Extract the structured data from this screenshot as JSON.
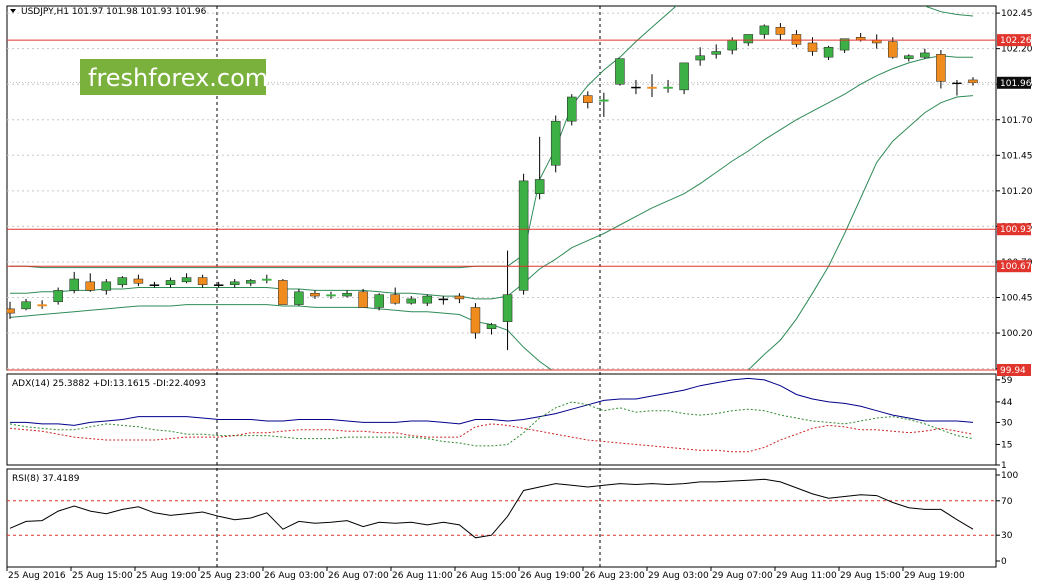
{
  "main_header": "USDJPY,H1  101.97 101.98 101.93 101.96",
  "adx_header": "ADX(14) 25.3882 +DI:13.1615 -DI:22.4093",
  "rsi_header": "RSI(8) 37.4189",
  "watermark": "freshforex.com",
  "colors": {
    "bull": "#3cb044",
    "bear": "#f08c1e",
    "hline": "#e0342c",
    "band": "#2e8b57",
    "adx": "#00008b",
    "plus_di": "#2e8b2e",
    "minus_di": "#cc2222",
    "rsi": "#000000",
    "grid": "#c8c8c8",
    "price_badge": "#0c0c0c",
    "level_badge": "#e0342c"
  },
  "chart_data": [
    {
      "type": "candlestick",
      "symbol": "USDJPY",
      "timeframe": "H1",
      "ylim": [
        99.94,
        102.5
      ],
      "y_ticks": [
        "102.45",
        "102.20",
        "101.95",
        "101.70",
        "101.45",
        "101.20",
        "100.95",
        "100.70",
        "100.45",
        "100.20",
        "99.95"
      ],
      "x_tick_labels": [
        "25 Aug 2016",
        "25 Aug 15:00",
        "25 Aug 19:00",
        "25 Aug 23:00",
        "26 Aug 03:00",
        "26 Aug 07:00",
        "26 Aug 11:00",
        "26 Aug 15:00",
        "26 Aug 19:00",
        "26 Aug 23:00",
        "29 Aug 03:00",
        "29 Aug 07:00",
        "29 Aug 11:00",
        "29 Aug 15:00",
        "29 Aug 19:00"
      ],
      "current_price": "101.96",
      "horizontal_levels": [
        "102.26",
        "100.93",
        "100.67",
        "99.94"
      ],
      "candles": [
        [
          100.37,
          100.42,
          100.3,
          100.34
        ],
        [
          100.37,
          100.44,
          100.36,
          100.42
        ],
        [
          100.4,
          100.43,
          100.37,
          100.39
        ],
        [
          100.42,
          100.52,
          100.4,
          100.5
        ],
        [
          100.5,
          100.63,
          100.48,
          100.58
        ],
        [
          100.56,
          100.62,
          100.49,
          100.5
        ],
        [
          100.5,
          100.58,
          100.47,
          100.56
        ],
        [
          100.54,
          100.6,
          100.52,
          100.59
        ],
        [
          100.58,
          100.61,
          100.53,
          100.55
        ],
        [
          100.54,
          100.56,
          100.52,
          100.54
        ],
        [
          100.54,
          100.59,
          100.52,
          100.57
        ],
        [
          100.56,
          100.62,
          100.55,
          100.59
        ],
        [
          100.59,
          100.61,
          100.52,
          100.54
        ],
        [
          100.54,
          100.56,
          100.52,
          100.54
        ],
        [
          100.54,
          100.58,
          100.52,
          100.56
        ],
        [
          100.55,
          100.58,
          100.53,
          100.57
        ],
        [
          100.57,
          100.61,
          100.55,
          100.58
        ],
        [
          100.57,
          100.58,
          100.4,
          100.4
        ],
        [
          100.4,
          100.51,
          100.39,
          100.49
        ],
        [
          100.48,
          100.5,
          100.44,
          100.46
        ],
        [
          100.46,
          100.49,
          100.44,
          100.47
        ],
        [
          100.46,
          100.5,
          100.45,
          100.48
        ],
        [
          100.49,
          100.51,
          100.38,
          100.38
        ],
        [
          100.38,
          100.48,
          100.36,
          100.47
        ],
        [
          100.47,
          100.52,
          100.4,
          100.41
        ],
        [
          100.41,
          100.46,
          100.4,
          100.44
        ],
        [
          100.41,
          100.47,
          100.39,
          100.46
        ],
        [
          100.44,
          100.46,
          100.4,
          100.44
        ],
        [
          100.46,
          100.48,
          100.41,
          100.44
        ],
        [
          100.38,
          100.41,
          100.16,
          100.2
        ],
        [
          100.23,
          100.27,
          100.19,
          100.26
        ],
        [
          100.28,
          100.78,
          100.08,
          100.47
        ],
        [
          100.5,
          101.32,
          100.47,
          101.27
        ],
        [
          101.18,
          101.58,
          101.14,
          101.28
        ],
        [
          101.38,
          101.73,
          101.33,
          101.69
        ],
        [
          101.69,
          101.88,
          101.66,
          101.86
        ],
        [
          101.87,
          101.9,
          101.78,
          101.82
        ],
        [
          101.83,
          101.89,
          101.72,
          101.84
        ],
        [
          101.95,
          102.12,
          101.94,
          102.13
        ],
        [
          101.93,
          101.98,
          101.88,
          101.93
        ],
        [
          101.93,
          102.02,
          101.86,
          101.92
        ],
        [
          101.92,
          101.98,
          101.89,
          101.93
        ],
        [
          101.91,
          102.1,
          101.88,
          102.1
        ],
        [
          102.12,
          102.21,
          102.08,
          102.15
        ],
        [
          102.16,
          102.23,
          102.13,
          102.18
        ],
        [
          102.19,
          102.28,
          102.16,
          102.26
        ],
        [
          102.24,
          102.3,
          102.22,
          102.3
        ],
        [
          102.3,
          102.37,
          102.27,
          102.36
        ],
        [
          102.35,
          102.38,
          102.26,
          102.3
        ],
        [
          102.3,
          102.33,
          102.21,
          102.23
        ],
        [
          102.24,
          102.28,
          102.15,
          102.18
        ],
        [
          102.14,
          102.22,
          102.12,
          102.21
        ],
        [
          102.19,
          102.27,
          102.17,
          102.27
        ],
        [
          102.28,
          102.31,
          102.25,
          102.26
        ],
        [
          102.26,
          102.3,
          102.2,
          102.24
        ],
        [
          102.25,
          102.28,
          102.13,
          102.14
        ],
        [
          102.13,
          102.16,
          102.11,
          102.15
        ],
        [
          102.14,
          102.2,
          102.13,
          102.17
        ],
        [
          102.16,
          102.19,
          101.92,
          101.97
        ],
        [
          101.96,
          101.98,
          101.87,
          101.96
        ],
        [
          101.98,
          102.0,
          101.94,
          101.96
        ]
      ],
      "series": [
        {
          "name": "bollinger_upper",
          "values": [
            100.67,
            100.67,
            100.66,
            100.66,
            100.66,
            100.66,
            100.66,
            100.66,
            100.66,
            100.66,
            100.66,
            100.66,
            100.66,
            100.66,
            100.66,
            100.66,
            100.66,
            100.66,
            100.66,
            100.66,
            100.66,
            100.66,
            100.66,
            100.66,
            100.66,
            100.66,
            100.66,
            100.66,
            100.66,
            100.67,
            100.67,
            100.67,
            100.75,
            101.28,
            101.5,
            101.8,
            101.94,
            102.05,
            102.14,
            102.25,
            102.35,
            102.45,
            102.55,
            102.6,
            102.65,
            102.7,
            102.75,
            102.8,
            102.85,
            102.9,
            102.95,
            103.0,
            102.98,
            102.95,
            102.85,
            102.7,
            102.6,
            102.5,
            102.46,
            102.44,
            102.43
          ]
        },
        {
          "name": "bollinger_middle",
          "values": [
            100.48,
            100.48,
            100.49,
            100.49,
            100.5,
            100.5,
            100.51,
            100.51,
            100.52,
            100.52,
            100.52,
            100.52,
            100.52,
            100.52,
            100.52,
            100.52,
            100.52,
            100.51,
            100.51,
            100.5,
            100.5,
            100.5,
            100.5,
            100.49,
            100.48,
            100.48,
            100.47,
            100.46,
            100.46,
            100.44,
            100.44,
            100.46,
            100.55,
            100.65,
            100.72,
            100.8,
            100.85,
            100.9,
            100.96,
            101.02,
            101.08,
            101.13,
            101.18,
            101.25,
            101.33,
            101.41,
            101.48,
            101.56,
            101.63,
            101.7,
            101.76,
            101.82,
            101.88,
            101.95,
            102.01,
            102.06,
            102.1,
            102.13,
            102.15,
            102.14,
            102.14
          ]
        },
        {
          "name": "bollinger_lower",
          "values": [
            100.31,
            100.32,
            100.33,
            100.34,
            100.35,
            100.36,
            100.37,
            100.38,
            100.39,
            100.39,
            100.39,
            100.4,
            100.4,
            100.4,
            100.4,
            100.4,
            100.4,
            100.39,
            100.39,
            100.38,
            100.38,
            100.38,
            100.38,
            100.37,
            100.36,
            100.35,
            100.35,
            100.34,
            100.33,
            100.28,
            100.26,
            100.22,
            100.1,
            100.0,
            99.92,
            99.85,
            99.78,
            99.7,
            99.62,
            99.55,
            99.5,
            99.46,
            99.5,
            99.6,
            99.72,
            99.85,
            99.94,
            100.05,
            100.15,
            100.3,
            100.48,
            100.67,
            100.9,
            101.15,
            101.4,
            101.55,
            101.65,
            101.75,
            101.82,
            101.86,
            101.87
          ]
        }
      ]
    },
    {
      "type": "line",
      "title": "ADX(14) 25.3882 +DI:13.1615 -DI:22.4093",
      "ylim": [
        1,
        63
      ],
      "y_ticks": [
        "59",
        "44",
        "30",
        "15",
        "1"
      ],
      "series": [
        {
          "name": "ADX",
          "values": [
            30,
            30,
            29,
            29,
            28,
            30,
            31,
            32,
            34,
            34,
            34,
            34,
            33,
            32,
            32,
            32,
            31,
            31,
            32,
            32,
            32,
            31,
            30,
            30,
            30,
            31,
            31,
            30,
            29,
            32,
            32,
            31,
            32,
            34,
            36,
            39,
            42,
            45,
            46,
            46,
            48,
            50,
            52,
            55,
            57,
            59,
            60,
            59,
            55,
            49,
            46,
            44,
            43,
            41,
            38,
            35,
            33,
            31,
            31,
            31,
            30
          ]
        },
        {
          "name": "+DI",
          "values": [
            29,
            27,
            26,
            25,
            25,
            27,
            29,
            28,
            27,
            25,
            24,
            22,
            22,
            21,
            21,
            21,
            21,
            20,
            19,
            19,
            19,
            20,
            20,
            20,
            20,
            20,
            19,
            17,
            16,
            14,
            14,
            15,
            23,
            33,
            40,
            44,
            42,
            38,
            40,
            37,
            38,
            38,
            36,
            35,
            36,
            38,
            39,
            38,
            35,
            33,
            31,
            30,
            29,
            31,
            33,
            34,
            32,
            29,
            25,
            21,
            19
          ]
        },
        {
          "name": "-DI",
          "values": [
            26,
            25,
            24,
            22,
            20,
            19,
            18,
            18,
            18,
            18,
            19,
            20,
            20,
            20,
            21,
            23,
            23,
            24,
            25,
            25,
            25,
            24,
            24,
            23,
            23,
            21,
            20,
            20,
            20,
            27,
            29,
            28,
            26,
            24,
            22,
            20,
            18,
            17,
            16,
            15,
            14,
            13,
            12,
            11,
            11,
            10,
            10,
            13,
            18,
            22,
            26,
            28,
            27,
            25,
            25,
            24,
            23,
            24,
            26,
            24,
            22
          ]
        }
      ]
    },
    {
      "type": "line",
      "title": "RSI(8) 37.4189",
      "ylim": [
        0,
        100
      ],
      "y_ticks": [
        "100",
        "70",
        "30",
        "0"
      ],
      "levels": [
        70,
        30
      ],
      "series": [
        {
          "name": "RSI(8)",
          "values": [
            38,
            46,
            47,
            58,
            64,
            58,
            55,
            60,
            63,
            56,
            53,
            55,
            57,
            52,
            48,
            50,
            56,
            37,
            46,
            44,
            45,
            47,
            40,
            45,
            44,
            45,
            42,
            45,
            42,
            27,
            30,
            52,
            82,
            86,
            90,
            88,
            86,
            88,
            90,
            89,
            90,
            89,
            90,
            92,
            92,
            93,
            94,
            95,
            92,
            85,
            78,
            73,
            75,
            77,
            76,
            68,
            62,
            60,
            60,
            48,
            37
          ]
        }
      ]
    }
  ]
}
